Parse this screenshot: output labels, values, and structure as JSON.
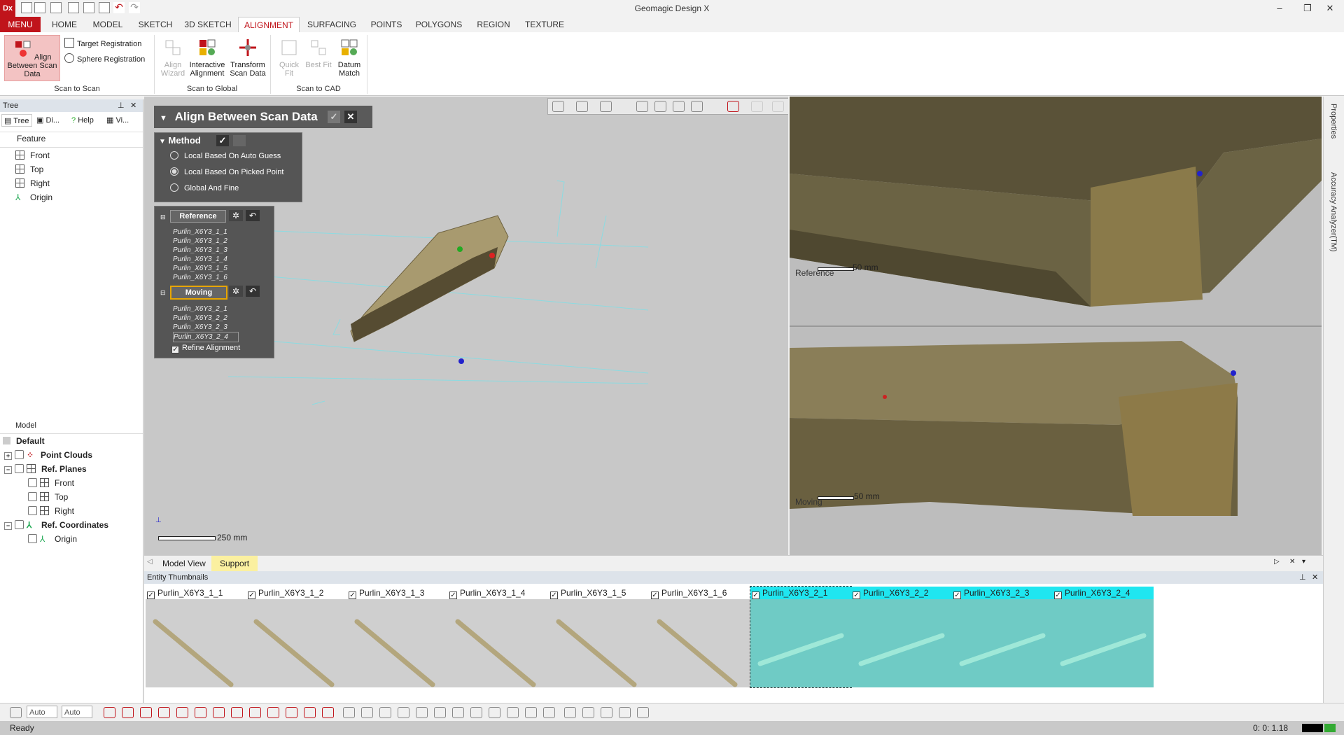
{
  "app": {
    "logo": "Dx",
    "title": "Geomagic Design X"
  },
  "window_controls": {
    "minimize": "–",
    "restore": "❐",
    "close": "✕"
  },
  "ribbon_tabs": [
    "MENU",
    "HOME",
    "MODEL",
    "SKETCH",
    "3D SKETCH",
    "ALIGNMENT",
    "SURFACING",
    "POINTS",
    "POLYGONS",
    "REGION",
    "TEXTURE"
  ],
  "ribbon": {
    "scan_to_scan": {
      "label": "Scan to Scan",
      "align_between": "Align Between Scan Data",
      "target_registration": "Target Registration",
      "sphere_registration": "Sphere Registration"
    },
    "scan_to_global": {
      "label": "Scan to Global",
      "align_wizard": "Align Wizard",
      "interactive_alignment": "Interactive Alignment",
      "transform_scan_data": "Transform Scan Data"
    },
    "scan_to_cad": {
      "label": "Scan to CAD",
      "quick_fit": "Quick Fit",
      "best_fit": "Best Fit",
      "datum_match": "Datum Match"
    }
  },
  "left_panel": {
    "title": "Tree",
    "tabs": [
      "Tree",
      "Di...",
      "Help",
      "Vi..."
    ],
    "feature_label": "Feature",
    "features": [
      "Front",
      "Top",
      "Right",
      "Origin"
    ],
    "model_label": "Model",
    "model_default": "Default",
    "model_items": {
      "point_clouds": "Point Clouds",
      "ref_planes": "Ref. Planes",
      "front": "Front",
      "top": "Top",
      "right": "Right",
      "ref_coordinates": "Ref. Coordinates",
      "origin": "Origin"
    }
  },
  "dialog": {
    "title": "Align Between Scan Data",
    "method_label": "Method",
    "methods": [
      "Local Based On Auto Guess",
      "Local Based On Picked Point",
      "Global And Fine"
    ],
    "selected_method": 1,
    "reference_label": "Reference",
    "reference_items": [
      "Purlin_X6Y3_1_1",
      "Purlin_X6Y3_1_2",
      "Purlin_X6Y3_1_3",
      "Purlin_X6Y3_1_4",
      "Purlin_X6Y3_1_5",
      "Purlin_X6Y3_1_6"
    ],
    "moving_label": "Moving",
    "moving_items": [
      "Purlin_X6Y3_2_1",
      "Purlin_X6Y3_2_2",
      "Purlin_X6Y3_2_3",
      "Purlin_X6Y3_2_4"
    ],
    "refine_label": "Refine Alignment"
  },
  "viewport": {
    "scale_main": "250 mm",
    "scale_ref": "50 mm",
    "scale_moving": "50 mm",
    "ref_label": "Reference",
    "moving_label": "Moving"
  },
  "right_sidebar": {
    "properties": "Properties",
    "accuracy": "Accuracy Analyzer(TM)"
  },
  "view_tabs": [
    "Model View",
    "Support"
  ],
  "thumbnails": {
    "title": "Entity Thumbnails",
    "items": [
      "Purlin_X6Y3_1_1",
      "Purlin_X6Y3_1_2",
      "Purlin_X6Y3_1_3",
      "Purlin_X6Y3_1_4",
      "Purlin_X6Y3_1_5",
      "Purlin_X6Y3_1_6",
      "Purlin_X6Y3_2_1",
      "Purlin_X6Y3_2_2",
      "Purlin_X6Y3_2_3",
      "Purlin_X6Y3_2_4"
    ]
  },
  "bottom_toolbar": {
    "auto1": "Auto",
    "auto2": "Auto"
  },
  "status": {
    "text": "Ready",
    "coords": "0: 0: 1.18"
  },
  "colors": {
    "accent": "#c0141b",
    "cyan": "#1fe6f0",
    "wood": "#8a7a52"
  }
}
